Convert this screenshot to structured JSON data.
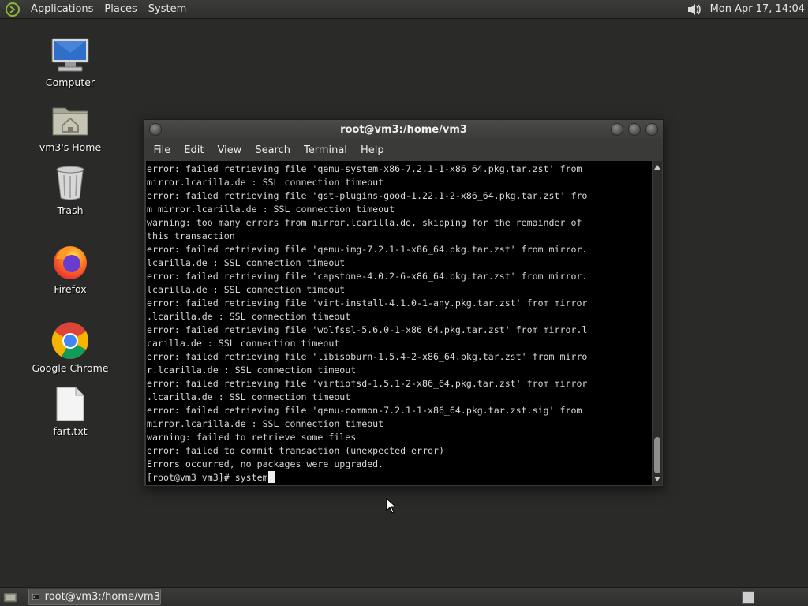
{
  "top_panel": {
    "menus": [
      "Applications",
      "Places",
      "System"
    ],
    "clock": "Mon Apr 17, 14:04"
  },
  "desktop": {
    "icons": [
      {
        "label": "Computer",
        "icon": "computer-icon"
      },
      {
        "label": "vm3's Home",
        "icon": "home-folder-icon"
      },
      {
        "label": "Trash",
        "icon": "trash-icon"
      },
      {
        "label": "Firefox",
        "icon": "firefox-icon"
      },
      {
        "label": "Google Chrome",
        "icon": "chrome-icon"
      },
      {
        "label": "fart.txt",
        "icon": "text-file-icon"
      }
    ]
  },
  "terminal": {
    "title": "root@vm3:/home/vm3",
    "menu": [
      "File",
      "Edit",
      "View",
      "Search",
      "Terminal",
      "Help"
    ],
    "lines": [
      "error: failed retrieving file 'qemu-system-x86-7.2.1-1-x86_64.pkg.tar.zst' from",
      "mirror.lcarilla.de : SSL connection timeout",
      "error: failed retrieving file 'gst-plugins-good-1.22.1-2-x86_64.pkg.tar.zst' fro",
      "m mirror.lcarilla.de : SSL connection timeout",
      "warning: too many errors from mirror.lcarilla.de, skipping for the remainder of",
      "this transaction",
      "error: failed retrieving file 'qemu-img-7.2.1-1-x86_64.pkg.tar.zst' from mirror.",
      "lcarilla.de : SSL connection timeout",
      "error: failed retrieving file 'capstone-4.0.2-6-x86_64.pkg.tar.zst' from mirror.",
      "lcarilla.de : SSL connection timeout",
      "error: failed retrieving file 'virt-install-4.1.0-1-any.pkg.tar.zst' from mirror",
      ".lcarilla.de : SSL connection timeout",
      "error: failed retrieving file 'wolfssl-5.6.0-1-x86_64.pkg.tar.zst' from mirror.l",
      "carilla.de : SSL connection timeout",
      "error: failed retrieving file 'libisoburn-1.5.4-2-x86_64.pkg.tar.zst' from mirro",
      "r.lcarilla.de : SSL connection timeout",
      "error: failed retrieving file 'virtiofsd-1.5.1-2-x86_64.pkg.tar.zst' from mirror",
      ".lcarilla.de : SSL connection timeout",
      "error: failed retrieving file 'qemu-common-7.2.1-1-x86_64.pkg.tar.zst.sig' from",
      "mirror.lcarilla.de : SSL connection timeout",
      "warning: failed to retrieve some files",
      "error: failed to commit transaction (unexpected error)",
      "Errors occurred, no packages were upgraded."
    ],
    "prompt": "[root@vm3 vm3]# ",
    "input": "system"
  },
  "taskbar": {
    "tasks": [
      {
        "label": "root@vm3:/home/vm3",
        "icon": "terminal-icon"
      }
    ]
  }
}
